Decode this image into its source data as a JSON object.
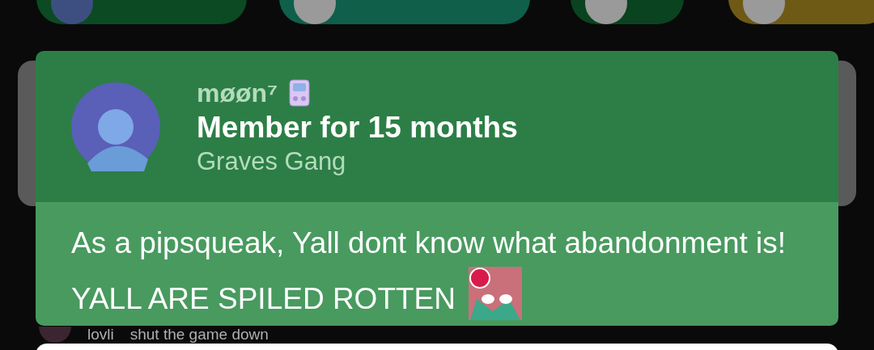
{
  "top_pills": [
    {
      "color": "#0b4a22",
      "kind": "photo"
    },
    {
      "color": "#0f5f4b",
      "kind": "silhouette"
    },
    {
      "color": "#0a4320",
      "kind": "silhouette"
    },
    {
      "color": "#6e5a14",
      "kind": "silhouette"
    }
  ],
  "profile_popup": {
    "name": "møøn⁷",
    "tenure": "Member for 15 months",
    "group": "Graves Gang",
    "message": "As a pipsqueak, Yall dont know what abandonment is! YALL ARE SPILED ROTTEN"
  },
  "chat_row": {
    "author": "lovli",
    "text": "shut the game down"
  }
}
